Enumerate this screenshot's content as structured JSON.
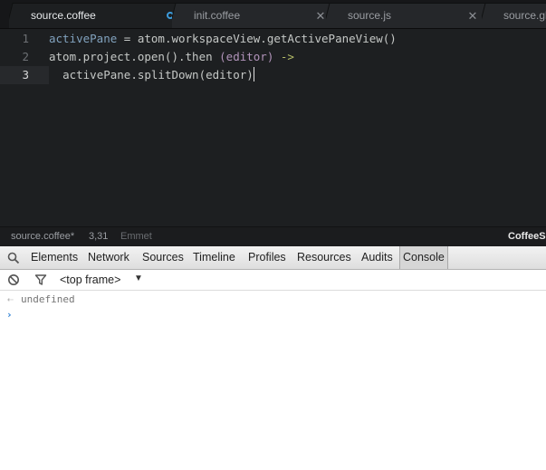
{
  "editor": {
    "tabs": [
      {
        "title": "source.coffee",
        "active": true,
        "modified": true
      },
      {
        "title": "init.coffee",
        "active": false,
        "modified": false
      },
      {
        "title": "source.js",
        "active": false,
        "modified": false
      },
      {
        "title": "source.gl",
        "active": false,
        "modified": false
      }
    ],
    "line_numbers": [
      "1",
      "2",
      "3"
    ],
    "code": {
      "line1": {
        "ident": "activePane",
        "rest": " = atom.workspaceView.getActivePaneView()"
      },
      "line2": {
        "head": "atom.project.open().then ",
        "param": "(editor)",
        "arrow": " ->"
      },
      "line3": {
        "indent": "  ",
        "call": "activePane.splitDown",
        "arg": "(editor)"
      }
    },
    "status": {
      "file": "source.coffee*",
      "position": "3,31",
      "plugin": "Emmet",
      "grammar": "CoffeeSc"
    }
  },
  "devtools": {
    "tabs": [
      "Elements",
      "Network",
      "Sources",
      "Timeline",
      "Profiles",
      "Resources",
      "Audits",
      "Console"
    ],
    "selected_tab": "Console",
    "frame": "<top frame>",
    "console": {
      "result": "undefined",
      "result_marker": "⇠",
      "prompt": "›"
    }
  }
}
